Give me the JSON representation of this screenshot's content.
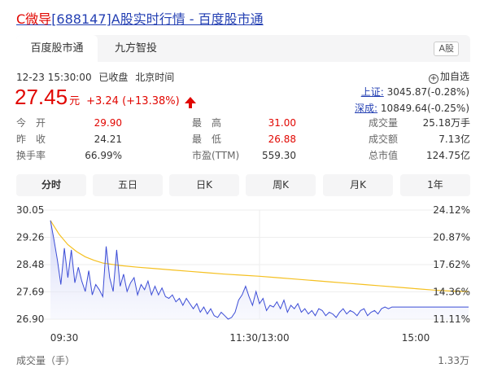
{
  "title": {
    "highlight": "C微导",
    "rest": "[688147]A股实时行情 - 百度股市通"
  },
  "tabs": [
    {
      "label": "百度股市通",
      "active": true
    },
    {
      "label": "九方智投",
      "active": false
    }
  ],
  "badge": "A股",
  "meta": {
    "datetime": "12-23 15:30:00",
    "status": "已收盘",
    "timezone": "北京时间"
  },
  "add_favorite": "加自选",
  "price": {
    "value": "27.45",
    "unit": "元",
    "change": "+3.24 (+13.38%)"
  },
  "indices": [
    {
      "label": "上证:",
      "value": "3045.87(-0.28%)"
    },
    {
      "label": "深成:",
      "value": "10849.64(-0.25%)"
    }
  ],
  "stats": [
    [
      {
        "label": "今　开",
        "value": "29.90",
        "red": true
      },
      {
        "label": "最　高",
        "value": "31.00",
        "red": true
      },
      {
        "label": "成交量",
        "value": "25.18万手"
      }
    ],
    [
      {
        "label": "昨　收",
        "value": "24.21"
      },
      {
        "label": "最　低",
        "value": "26.88",
        "red": true
      },
      {
        "label": "成交额",
        "value": "7.13亿"
      }
    ],
    [
      {
        "label": "换手率",
        "value": "66.99%"
      },
      {
        "label": "市盈(TTM)",
        "value": "559.30"
      },
      {
        "label": "总市值",
        "value": "124.75亿"
      }
    ]
  ],
  "period_tabs": [
    {
      "label": "分时",
      "active": true
    },
    {
      "label": "五日"
    },
    {
      "label": "日K"
    },
    {
      "label": "周K"
    },
    {
      "label": "月K"
    },
    {
      "label": "1年"
    }
  ],
  "volume": {
    "label": "成交量（手）",
    "max": "1.33万"
  },
  "colors": {
    "up": "#e10601",
    "link": "#2440b3",
    "price_line": "#3b4cd6",
    "avg_line": "#f5c020",
    "area_top": "#c9cdf5"
  },
  "chart_data": {
    "type": "line",
    "prev_close": 24.21,
    "y_ticks_left": [
      "30.05",
      "29.26",
      "28.48",
      "27.69",
      "26.90"
    ],
    "y_ticks_right": [
      "24.12%",
      "20.87%",
      "17.62%",
      "14.36%",
      "11.11%"
    ],
    "ylim": [
      26.9,
      30.05
    ],
    "x_ticks": [
      "09:30",
      "11:30/13:00",
      "15:00"
    ],
    "x_range": [
      0,
      240
    ],
    "series": [
      {
        "x": [
          0,
          2,
          4,
          6,
          8,
          10,
          12,
          14,
          16,
          18,
          20,
          22,
          24,
          26,
          28,
          30,
          32,
          34,
          36,
          38,
          40,
          42,
          44,
          46,
          48,
          50,
          52,
          54,
          56,
          58,
          60,
          62,
          64,
          66,
          68,
          70,
          72,
          74,
          76,
          78,
          80,
          82,
          84,
          86,
          88,
          90,
          92,
          94,
          96,
          98,
          100,
          102,
          104,
          106,
          108,
          110,
          112,
          114,
          116,
          118,
          120,
          122,
          124,
          126,
          128,
          130,
          132,
          134,
          136,
          138,
          140,
          142,
          144,
          146,
          148,
          150,
          152,
          154,
          156,
          158,
          160,
          162,
          164,
          166,
          168,
          170,
          172,
          174,
          176,
          178,
          180,
          182,
          184,
          186,
          188,
          190,
          192,
          194,
          196,
          198,
          200,
          202,
          204,
          206,
          208,
          210,
          212,
          214,
          216,
          218,
          220,
          222,
          224,
          226,
          228,
          230,
          232,
          234,
          236,
          238,
          240
        ],
        "values": [
          29.75,
          29.2,
          28.6,
          27.9,
          28.95,
          28.1,
          28.9,
          27.95,
          28.4,
          28.0,
          27.7,
          28.3,
          27.6,
          27.9,
          27.75,
          27.55,
          29.0,
          28.1,
          27.7,
          28.9,
          27.85,
          28.2,
          27.7,
          27.95,
          28.1,
          27.6,
          27.9,
          27.75,
          28.0,
          27.6,
          27.85,
          27.6,
          27.8,
          27.55,
          27.5,
          27.6,
          27.4,
          27.5,
          27.3,
          27.5,
          27.35,
          27.2,
          27.35,
          27.1,
          27.25,
          27.05,
          27.2,
          27.0,
          26.95,
          27.1,
          27.0,
          26.9,
          26.95,
          27.1,
          27.45,
          27.6,
          27.85,
          27.55,
          27.3,
          27.7,
          27.35,
          27.5,
          27.15,
          27.3,
          27.25,
          27.4,
          27.2,
          27.45,
          27.1,
          27.3,
          27.2,
          27.35,
          27.1,
          27.2,
          27.05,
          27.15,
          27.0,
          27.2,
          27.15,
          27.0,
          27.1,
          27.05,
          26.95,
          27.1,
          27.2,
          27.05,
          27.15,
          27.1,
          27.0,
          27.15,
          27.2,
          27.0,
          27.1,
          27.15,
          27.05,
          27.2,
          27.25,
          27.2,
          27.25,
          27.25,
          27.25,
          27.25,
          27.25,
          27.25,
          27.25,
          27.25,
          27.25,
          27.25,
          27.25,
          27.25,
          27.25,
          27.25,
          27.25,
          27.25,
          27.25,
          27.25,
          27.25,
          27.25,
          27.25,
          27.25,
          27.25
        ]
      },
      {
        "x": [
          0,
          5,
          10,
          15,
          20,
          25,
          30,
          40,
          50,
          60,
          70,
          80,
          90,
          100,
          110,
          120,
          130,
          140,
          150,
          160,
          170,
          180,
          190,
          200,
          210,
          220,
          230,
          240
        ],
        "values": [
          29.75,
          29.35,
          29.05,
          28.85,
          28.7,
          28.6,
          28.52,
          28.45,
          28.4,
          28.36,
          28.32,
          28.28,
          28.24,
          28.2,
          28.17,
          28.14,
          28.1,
          28.06,
          28.02,
          27.98,
          27.94,
          27.9,
          27.86,
          27.82,
          27.78,
          27.74,
          27.71,
          27.7
        ]
      }
    ]
  }
}
